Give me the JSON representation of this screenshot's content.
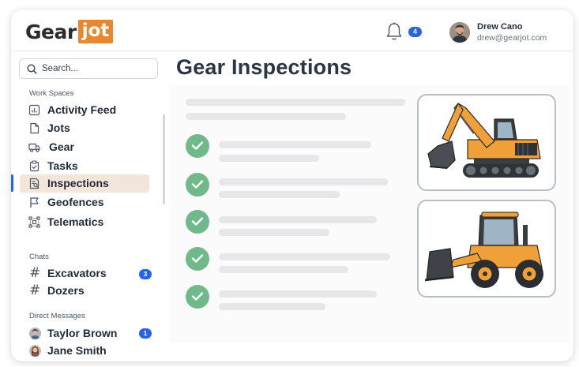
{
  "header": {
    "logo_left": "Gear",
    "logo_right": "jot",
    "notification_count": "4",
    "user": {
      "name": "Drew Cano",
      "email": "drew@gearjot.com"
    }
  },
  "sidebar": {
    "search": {
      "placeholder": "Search..."
    },
    "workspaces_label": "Work Spaces",
    "workspaces": [
      {
        "label": "Activity Feed",
        "icon": "activity-chart-icon"
      },
      {
        "label": "Jots",
        "icon": "document-icon"
      },
      {
        "label": "Gear",
        "icon": "truck-icon"
      },
      {
        "label": "Tasks",
        "icon": "clipboard-check-icon"
      },
      {
        "label": "Inspections",
        "icon": "inspection-doc-icon",
        "active": true
      },
      {
        "label": "Geofences",
        "icon": "flag-icon"
      },
      {
        "label": "Telematics",
        "icon": "network-icon"
      }
    ],
    "chats_label": "Chats",
    "chats": [
      {
        "label": "Excavators",
        "icon": "hash-icon",
        "count": "3"
      },
      {
        "label": "Dozers",
        "icon": "hash-icon"
      }
    ],
    "dm_label": "Direct Messages",
    "direct_messages": [
      {
        "label": "Taylor Brown",
        "count": "1"
      },
      {
        "label": "Jane Smith"
      }
    ]
  },
  "main": {
    "title": "Gear Inspections",
    "checklist_items": 5,
    "images": [
      "excavator-illustration",
      "wheel-loader-illustration"
    ]
  },
  "colors": {
    "brand_orange": "#e8872b",
    "accent_blue": "#2563eb",
    "check_green": "#6fb98a",
    "active_bg": "#f2e6db"
  }
}
